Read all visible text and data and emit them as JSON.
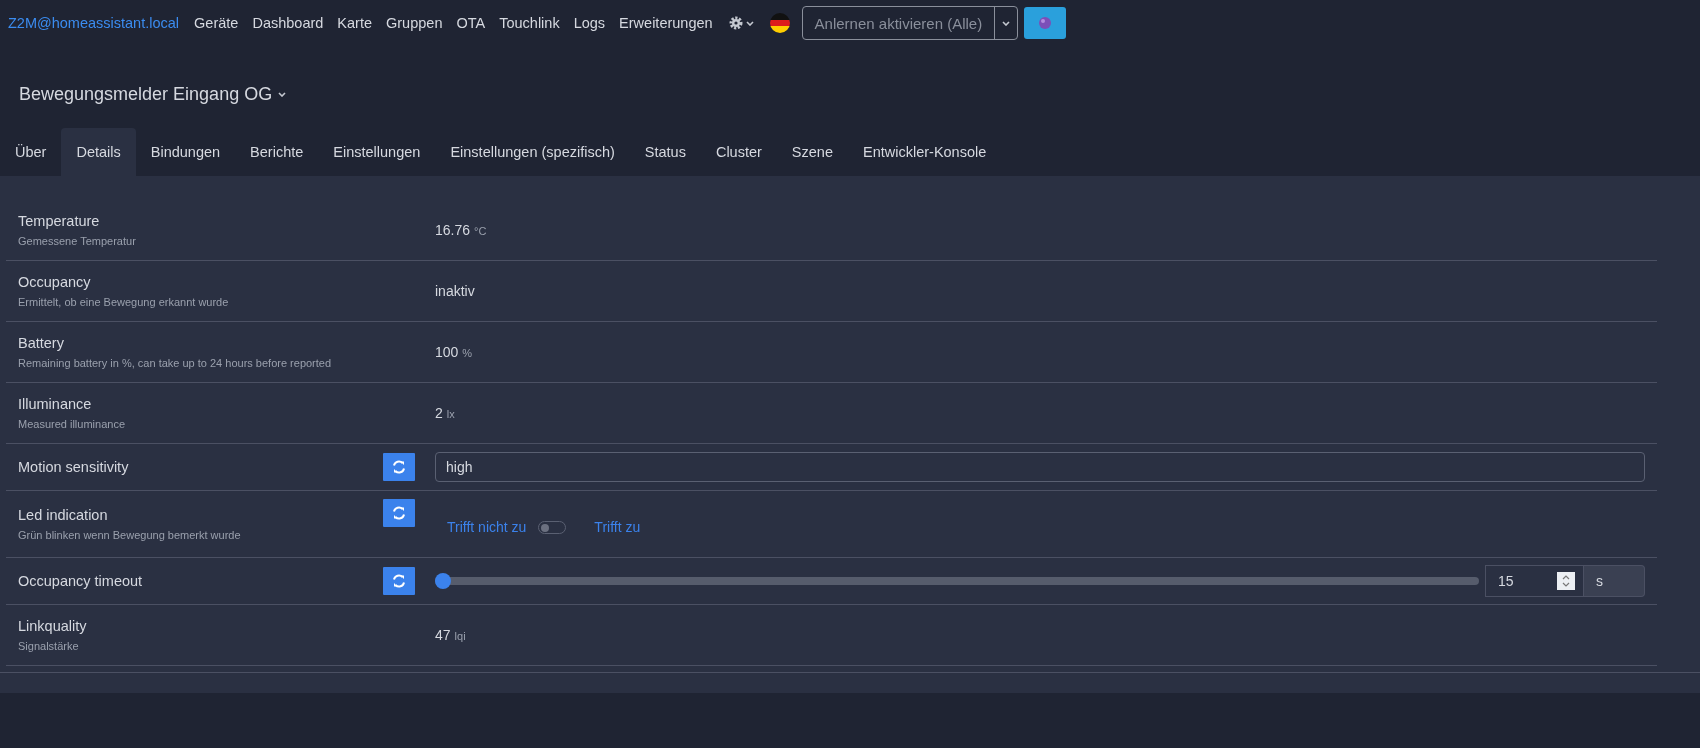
{
  "navbar": {
    "brand": "Z2M@homeassistant.local",
    "links": [
      "Geräte",
      "Dashboard",
      "Karte",
      "Gruppen",
      "OTA",
      "Touchlink",
      "Logs",
      "Erweiterungen"
    ],
    "pairing": {
      "label": "Anlernen aktivieren (Alle)"
    }
  },
  "device_title": "Bewegungsmelder Eingang OG",
  "tabs": [
    {
      "label": "Über",
      "selected": false
    },
    {
      "label": "Details",
      "selected": true
    },
    {
      "label": "Bindungen",
      "selected": false
    },
    {
      "label": "Berichte",
      "selected": false
    },
    {
      "label": "Einstellungen",
      "selected": false
    },
    {
      "label": "Einstellungen (spezifisch)",
      "selected": false
    },
    {
      "label": "Status",
      "selected": false
    },
    {
      "label": "Cluster",
      "selected": false
    },
    {
      "label": "Szene",
      "selected": false
    },
    {
      "label": "Entwickler-Konsole",
      "selected": false
    }
  ],
  "rows": [
    {
      "kind": "reading",
      "title": "Temperature",
      "description": "Gemessene Temperatur",
      "value": "16.76",
      "unit": "°C"
    },
    {
      "kind": "reading",
      "title": "Occupancy",
      "description": "Ermittelt, ob eine Bewegung erkannt wurde",
      "value": "inaktiv"
    },
    {
      "kind": "reading",
      "title": "Battery",
      "description": "Remaining battery in %, can take up to 24 hours before reported",
      "value": "100",
      "unit": "%"
    },
    {
      "kind": "reading",
      "title": "Illuminance",
      "description": "Measured illuminance",
      "value": "2",
      "unit": "lx"
    },
    {
      "kind": "select",
      "title": "Motion sensitivity",
      "value": "high"
    },
    {
      "kind": "toggle",
      "title": "Led indication",
      "description": "Grün blinken wenn Bewegung bemerkt wurde",
      "off_label": "Trifft nicht zu",
      "on_label": "Trifft zu",
      "on": false
    },
    {
      "kind": "slider",
      "title": "Occupancy timeout",
      "level": 0,
      "value": "15",
      "unit": "s"
    },
    {
      "kind": "reading",
      "title": "Linkquality",
      "description": "Signalstärke",
      "value": "47",
      "unit": "lqi"
    }
  ]
}
